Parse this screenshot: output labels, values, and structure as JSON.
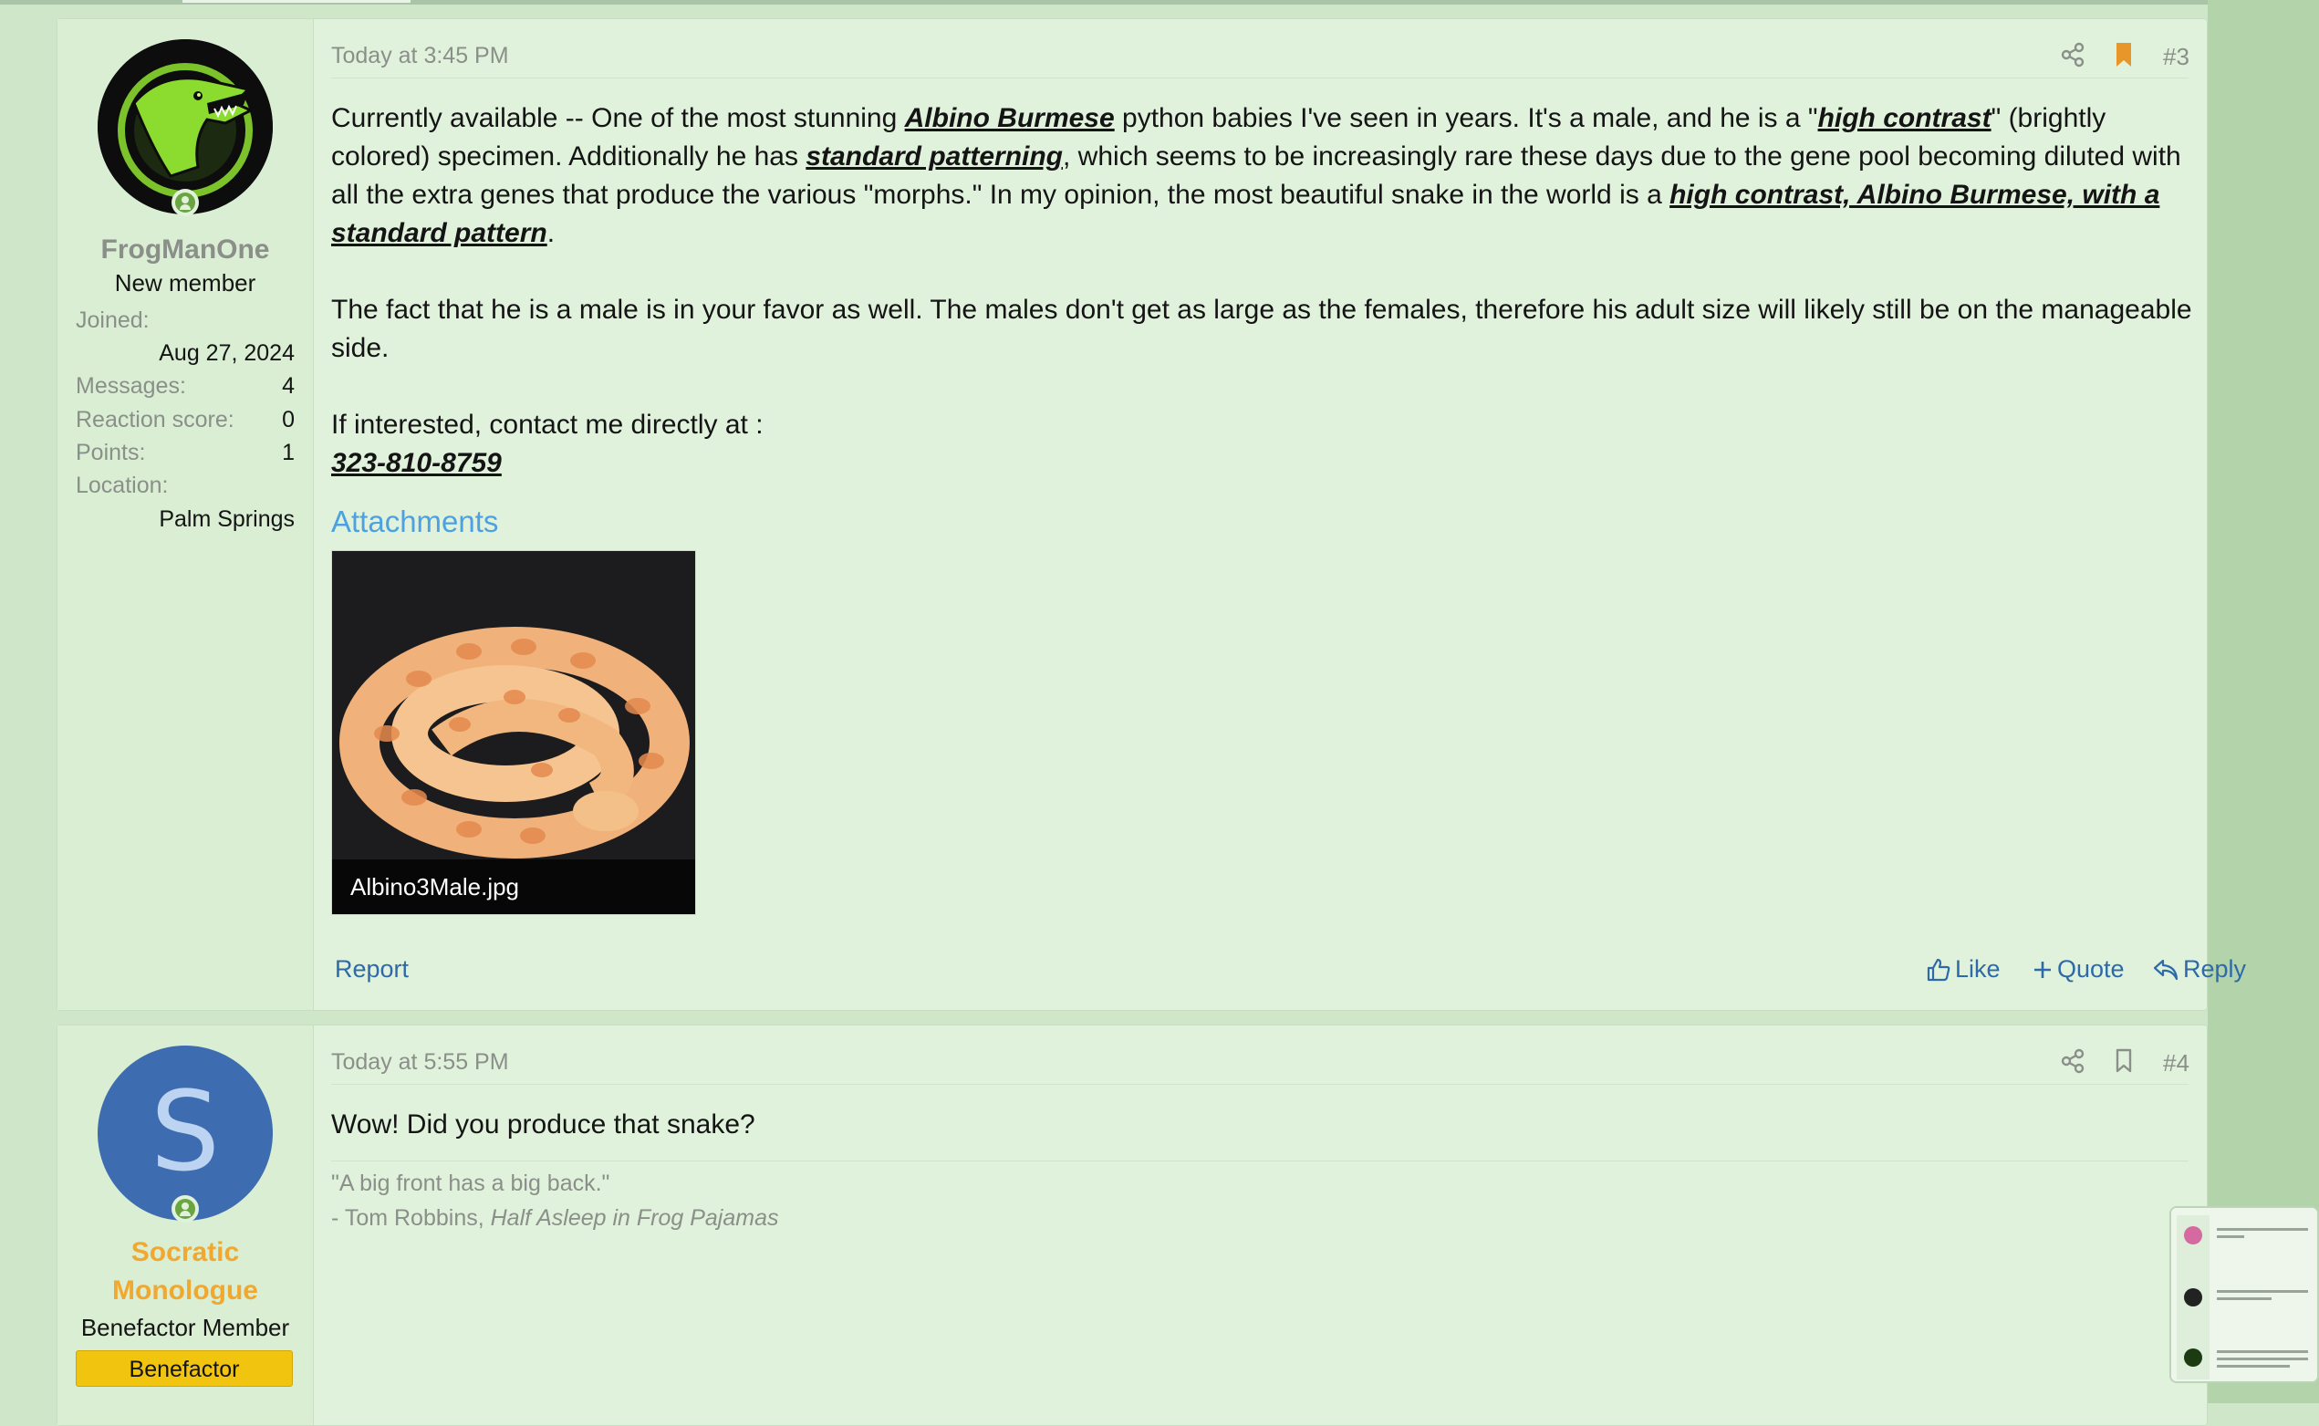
{
  "post3": {
    "author": "FrogManOne",
    "user_title": "New member",
    "stats": [
      {
        "label": "Joined:",
        "value": "Aug 27, 2024"
      },
      {
        "label": "Messages:",
        "value": "4"
      },
      {
        "label": "Reaction score:",
        "value": "0"
      },
      {
        "label": "Points:",
        "value": "1"
      },
      {
        "label": "Location:",
        "value": "Palm Springs"
      }
    ],
    "date": "Today at 3:45 PM",
    "number": "#3",
    "body": {
      "p1_a": "Currently available -- One of the most stunning ",
      "p1_b": "Albino Burmese",
      "p1_c": " python babies I've seen in years. It's a male, and he is a \"",
      "p1_d": "high contrast",
      "p1_e": "\" (brightly colored) specimen. Additionally he has ",
      "p1_f": "standard patterning",
      "p1_g": ", which seems to be increasingly rare these days due to the gene pool becoming diluted with all the extra genes that produce the various \"morphs.\" In my opinion, the most beautiful snake in the world is a ",
      "p1_h": "high contrast, Albino Burmese, with a standard pattern",
      "p1_i": ".",
      "p2": "The fact that he is a male is in your favor as well. The males don't get as large as the females, therefore his adult size will likely still be on the manageable side.",
      "p3": "If interested, contact me directly at :",
      "phone": "323-810-8759"
    },
    "attachments_title": "Attachments",
    "attachment_name": "Albino3Male.jpg",
    "report": "Report",
    "like": "Like",
    "quote": "Quote",
    "reply": "Reply"
  },
  "post4": {
    "avatar_letter": "S",
    "author_line1": "Socratic",
    "author_line2": "Monologue",
    "user_title": "Benefactor Member",
    "badge": "Benefactor",
    "date": "Today at 5:55 PM",
    "number": "#4",
    "body": "Wow! Did you produce that snake?",
    "signature_quote": "\"A big front has a big back.\"",
    "signature_author": "- Tom Robbins, ",
    "signature_book": "Half Asleep in Frog Pajamas"
  },
  "colors": {
    "page_bg": "#cfe6c9",
    "post_bg": "#e1f2dc",
    "link": "#2d6aa7",
    "attachments_title": "#4da1e0",
    "bookmark_active": "#e8962a",
    "username_benefactor": "#f0a830",
    "badge_bg": "#f1c40f"
  },
  "icons": [
    "share-icon",
    "bookmark-icon",
    "like-icon",
    "quote-plus-icon",
    "reply-icon",
    "online-status-icon"
  ]
}
